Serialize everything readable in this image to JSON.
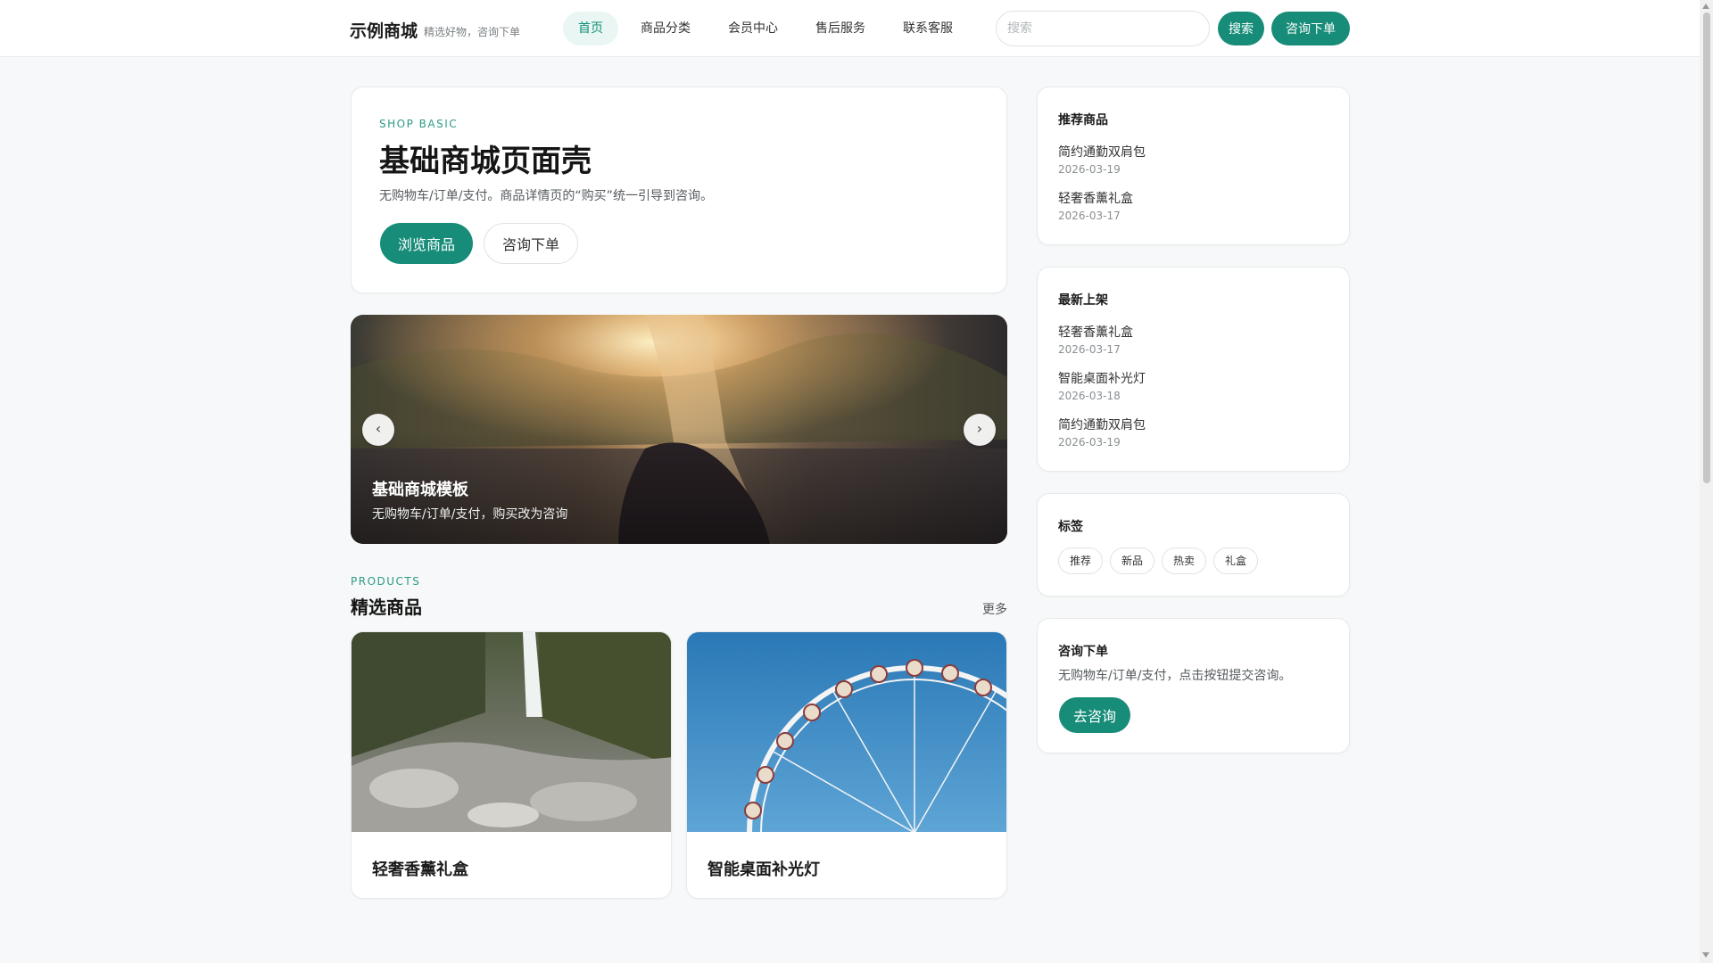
{
  "header": {
    "brand": "示例商城",
    "tagline": "精选好物，咨询下单",
    "nav": [
      {
        "label": "首页",
        "active": true
      },
      {
        "label": "商品分类",
        "active": false
      },
      {
        "label": "会员中心",
        "active": false
      },
      {
        "label": "售后服务",
        "active": false
      },
      {
        "label": "联系客服",
        "active": false
      }
    ],
    "search_placeholder": "搜索",
    "search_button": "搜索",
    "consult_button": "咨询下单"
  },
  "hero": {
    "eyebrow": "SHOP BASIC",
    "title": "基础商城页面壳",
    "description": "无购物车/订单/支付。商品详情页的“购买”统一引导到咨询。",
    "browse_button": "浏览商品",
    "consult_button": "咨询下单"
  },
  "carousel": {
    "title": "基础商城模板",
    "subtitle": "无购物车/订单/支付，购买改为咨询",
    "prev_icon": "‹",
    "next_icon": "›"
  },
  "products_section": {
    "eyebrow": "PRODUCTS",
    "title": "精选商品",
    "more": "更多",
    "items": [
      {
        "name": "轻奢香薰礼盒",
        "image": "waterfall-photo"
      },
      {
        "name": "智能桌面补光灯",
        "image": "ferris-wheel-photo"
      }
    ]
  },
  "sidebar": {
    "recommended": {
      "title": "推荐商品",
      "items": [
        {
          "name": "简约通勤双肩包",
          "date": "2026-03-19"
        },
        {
          "name": "轻奢香薰礼盒",
          "date": "2026-03-17"
        }
      ]
    },
    "latest": {
      "title": "最新上架",
      "items": [
        {
          "name": "轻奢香薰礼盒",
          "date": "2026-03-17"
        },
        {
          "name": "智能桌面补光灯",
          "date": "2026-03-18"
        },
        {
          "name": "简约通勤双肩包",
          "date": "2026-03-19"
        }
      ]
    },
    "tags": {
      "title": "标签",
      "items": [
        "推荐",
        "新品",
        "热卖",
        "礼盒"
      ]
    },
    "consult": {
      "title": "咨询下单",
      "description": "无购物车/订单/支付，点击按钮提交咨询。",
      "button": "去咨询"
    }
  },
  "colors": {
    "accent": "#178c78",
    "accent_light": "#eaf6f3",
    "page_bg": "#f6f8f9"
  }
}
